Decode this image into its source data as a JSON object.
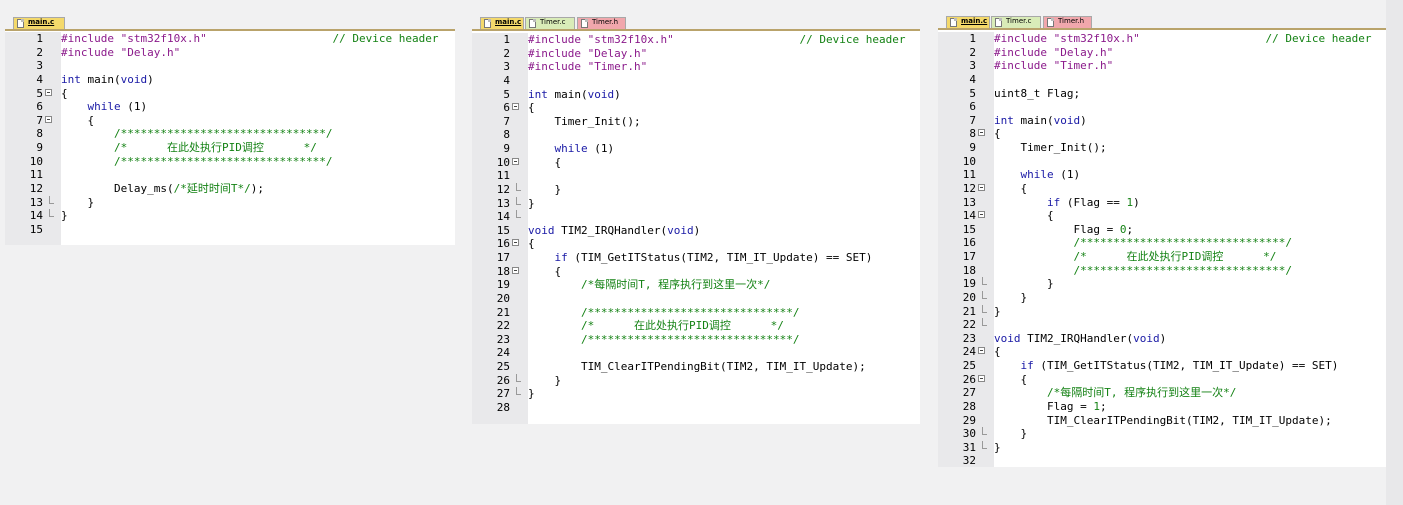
{
  "colors": {
    "keyword": "#1a1aa6",
    "string": "#8b1a8b",
    "comment": "#148214",
    "preprocessor": "#8b1a8b",
    "number": "#148214"
  },
  "icons": {
    "file_tab": "file-icon",
    "fold_open": "fold-minus-icon"
  },
  "panels": [
    {
      "tabs": [
        {
          "label": "main.c",
          "active": true,
          "kind": "main"
        }
      ],
      "lines": [
        [
          [
            "p",
            "#include "
          ],
          [
            "s",
            "\"stm32f10x.h\""
          ],
          [
            "d",
            "                   "
          ],
          [
            "c",
            "// Device header"
          ]
        ],
        [
          [
            "p",
            "#include "
          ],
          [
            "s",
            "\"Delay.h\""
          ]
        ],
        [],
        [
          [
            "k",
            "int"
          ],
          [
            "d",
            " main("
          ],
          [
            "k",
            "void"
          ],
          [
            "d",
            ")"
          ]
        ],
        [
          [
            "d",
            "{"
          ]
        ],
        [
          [
            "d",
            "    "
          ],
          [
            "k",
            "while"
          ],
          [
            "d",
            " (1)"
          ]
        ],
        [
          [
            "d",
            "    {"
          ]
        ],
        [
          [
            "d",
            "        "
          ],
          [
            "c",
            "/*******************************/"
          ]
        ],
        [
          [
            "d",
            "        "
          ],
          [
            "c",
            "/*      在此处执行PID调控      */"
          ]
        ],
        [
          [
            "d",
            "        "
          ],
          [
            "c",
            "/*******************************/"
          ]
        ],
        [],
        [
          [
            "d",
            "        Delay_ms("
          ],
          [
            "c",
            "/*延时时间T*/"
          ],
          [
            "d",
            ");"
          ]
        ],
        [
          [
            "d",
            "    }"
          ]
        ],
        [
          [
            "d",
            "}"
          ]
        ],
        []
      ],
      "folds": [
        "",
        "",
        "",
        "",
        "open",
        "",
        "open",
        "",
        "",
        "",
        "",
        "",
        "end",
        "end",
        ""
      ]
    },
    {
      "tabs": [
        {
          "label": "main.c",
          "active": true,
          "kind": "main"
        },
        {
          "label": "Timer.c",
          "active": false,
          "kind": "c"
        },
        {
          "label": "Timer.h",
          "active": false,
          "kind": "h"
        }
      ],
      "lines": [
        [
          [
            "p",
            "#include "
          ],
          [
            "s",
            "\"stm32f10x.h\""
          ],
          [
            "d",
            "                   "
          ],
          [
            "c",
            "// Device header"
          ]
        ],
        [
          [
            "p",
            "#include "
          ],
          [
            "s",
            "\"Delay.h\""
          ]
        ],
        [
          [
            "p",
            "#include "
          ],
          [
            "s",
            "\"Timer.h\""
          ]
        ],
        [],
        [
          [
            "k",
            "int"
          ],
          [
            "d",
            " main("
          ],
          [
            "k",
            "void"
          ],
          [
            "d",
            ")"
          ]
        ],
        [
          [
            "d",
            "{"
          ]
        ],
        [
          [
            "d",
            "    Timer_Init();"
          ]
        ],
        [],
        [
          [
            "d",
            "    "
          ],
          [
            "k",
            "while"
          ],
          [
            "d",
            " (1)"
          ]
        ],
        [
          [
            "d",
            "    {"
          ]
        ],
        [],
        [
          [
            "d",
            "    }"
          ]
        ],
        [
          [
            "d",
            "}"
          ]
        ],
        [],
        [
          [
            "k",
            "void"
          ],
          [
            "d",
            " TIM2_IRQHandler("
          ],
          [
            "k",
            "void"
          ],
          [
            "d",
            ")"
          ]
        ],
        [
          [
            "d",
            "{"
          ]
        ],
        [
          [
            "d",
            "    "
          ],
          [
            "k",
            "if"
          ],
          [
            "d",
            " (TIM_GetITStatus(TIM2, TIM_IT_Update) == SET)"
          ]
        ],
        [
          [
            "d",
            "    {"
          ]
        ],
        [
          [
            "d",
            "        "
          ],
          [
            "c",
            "/*每隔时间T, 程序执行到这里一次*/"
          ]
        ],
        [],
        [
          [
            "d",
            "        "
          ],
          [
            "c",
            "/*******************************/"
          ]
        ],
        [
          [
            "d",
            "        "
          ],
          [
            "c",
            "/*      在此处执行PID调控      */"
          ]
        ],
        [
          [
            "d",
            "        "
          ],
          [
            "c",
            "/*******************************/"
          ]
        ],
        [],
        [
          [
            "d",
            "        TIM_ClearITPendingBit(TIM2, TIM_IT_Update);"
          ]
        ],
        [
          [
            "d",
            "    }"
          ]
        ],
        [
          [
            "d",
            "}"
          ]
        ],
        []
      ],
      "folds": [
        "",
        "",
        "",
        "",
        "",
        "open",
        "",
        "",
        "",
        "open",
        "",
        "end",
        "end",
        "end",
        "",
        "open",
        "",
        "open",
        "",
        "",
        "",
        "",
        "",
        "",
        "",
        "end",
        "end",
        ""
      ]
    },
    {
      "tabs": [
        {
          "label": "main.c",
          "active": true,
          "kind": "main"
        },
        {
          "label": "Timer.c",
          "active": false,
          "kind": "c"
        },
        {
          "label": "Timer.h",
          "active": false,
          "kind": "h"
        }
      ],
      "lines": [
        [
          [
            "p",
            "#include "
          ],
          [
            "s",
            "\"stm32f10x.h\""
          ],
          [
            "d",
            "                   "
          ],
          [
            "c",
            "// Device header"
          ]
        ],
        [
          [
            "p",
            "#include "
          ],
          [
            "s",
            "\"Delay.h\""
          ]
        ],
        [
          [
            "p",
            "#include "
          ],
          [
            "s",
            "\"Timer.h\""
          ]
        ],
        [],
        [
          [
            "d",
            "uint8_t Flag;"
          ]
        ],
        [],
        [
          [
            "k",
            "int"
          ],
          [
            "d",
            " main("
          ],
          [
            "k",
            "void"
          ],
          [
            "d",
            ")"
          ]
        ],
        [
          [
            "d",
            "{"
          ]
        ],
        [
          [
            "d",
            "    Timer_Init();"
          ]
        ],
        [],
        [
          [
            "d",
            "    "
          ],
          [
            "k",
            "while"
          ],
          [
            "d",
            " (1)"
          ]
        ],
        [
          [
            "d",
            "    {"
          ]
        ],
        [
          [
            "d",
            "        "
          ],
          [
            "k",
            "if"
          ],
          [
            "d",
            " (Flag == "
          ],
          [
            "n",
            "1"
          ],
          [
            "d",
            ")"
          ]
        ],
        [
          [
            "d",
            "        {"
          ]
        ],
        [
          [
            "d",
            "            Flag = "
          ],
          [
            "n",
            "0"
          ],
          [
            "d",
            ";"
          ]
        ],
        [
          [
            "d",
            "            "
          ],
          [
            "c",
            "/*******************************/"
          ]
        ],
        [
          [
            "d",
            "            "
          ],
          [
            "c",
            "/*      在此处执行PID调控      */"
          ]
        ],
        [
          [
            "d",
            "            "
          ],
          [
            "c",
            "/*******************************/"
          ]
        ],
        [
          [
            "d",
            "        }"
          ]
        ],
        [
          [
            "d",
            "    }"
          ]
        ],
        [
          [
            "d",
            "}"
          ]
        ],
        [],
        [
          [
            "k",
            "void"
          ],
          [
            "d",
            " TIM2_IRQHandler("
          ],
          [
            "k",
            "void"
          ],
          [
            "d",
            ")"
          ]
        ],
        [
          [
            "d",
            "{"
          ]
        ],
        [
          [
            "d",
            "    "
          ],
          [
            "k",
            "if"
          ],
          [
            "d",
            " (TIM_GetITStatus(TIM2, TIM_IT_Update) == SET)"
          ]
        ],
        [
          [
            "d",
            "    {"
          ]
        ],
        [
          [
            "d",
            "        "
          ],
          [
            "c",
            "/*每隔时间T, 程序执行到这里一次*/"
          ]
        ],
        [
          [
            "d",
            "        Flag = "
          ],
          [
            "n",
            "1"
          ],
          [
            "d",
            ";"
          ]
        ],
        [
          [
            "d",
            "        TIM_ClearITPendingBit(TIM2, TIM_IT_Update);"
          ]
        ],
        [
          [
            "d",
            "    }"
          ]
        ],
        [
          [
            "d",
            "}"
          ]
        ],
        []
      ],
      "folds": [
        "",
        "",
        "",
        "",
        "",
        "",
        "",
        "open",
        "",
        "",
        "",
        "open",
        "",
        "open",
        "",
        "",
        "",
        "",
        "end",
        "end",
        "end",
        "end",
        "",
        "open",
        "",
        "open",
        "",
        "",
        "",
        "end",
        "end",
        ""
      ]
    }
  ]
}
